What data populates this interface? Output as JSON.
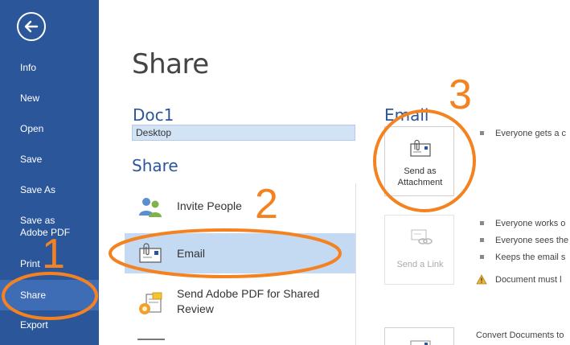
{
  "sidebar": {
    "items": [
      {
        "label": "Info"
      },
      {
        "label": "New"
      },
      {
        "label": "Open"
      },
      {
        "label": "Save"
      },
      {
        "label": "Save As"
      },
      {
        "label": "Save as Adobe PDF"
      },
      {
        "label": "Print"
      },
      {
        "label": "Share"
      },
      {
        "label": "Export"
      }
    ],
    "active": "Share"
  },
  "main": {
    "title": "Share",
    "doc_name": "Doc1",
    "doc_location": "Desktop",
    "share_heading": "Share",
    "options": [
      {
        "label": "Invite People"
      },
      {
        "label": "Email"
      },
      {
        "label": "Send Adobe PDF for Shared Review"
      }
    ],
    "selected_option": "Email"
  },
  "email_panel": {
    "heading": "Email",
    "send_attachment": "Send as Attachment",
    "send_link": "Send a Link",
    "attachment_bullets": [
      "Everyone gets a c"
    ],
    "link_bullets": [
      "Everyone works o",
      "Everyone sees the",
      "Keeps the email s"
    ],
    "link_warning": "Document must l",
    "convert_text": "Convert Documents to"
  },
  "annotations": {
    "n1": "1",
    "n2": "2",
    "n3": "3"
  },
  "colors": {
    "sidebar": "#2b579a",
    "accent": "#2b579a",
    "selected": "#c4daf3",
    "annotation": "#f58220"
  }
}
